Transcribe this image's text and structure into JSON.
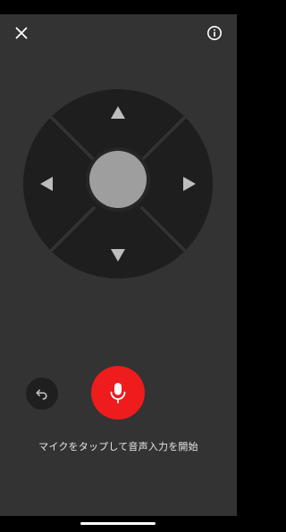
{
  "header": {
    "close_icon": "close-icon",
    "info_icon": "info-icon"
  },
  "dpad": {
    "up_icon": "arrow-up-icon",
    "down_icon": "arrow-down-icon",
    "left_icon": "arrow-left-icon",
    "right_icon": "arrow-right-icon"
  },
  "controls": {
    "undo_icon": "undo-icon",
    "mic_icon": "microphone-icon"
  },
  "hint": {
    "text": "マイクをタップして音声入力を開始"
  },
  "colors": {
    "background": "#333333",
    "dpad": "#1e1e1e",
    "center_button": "#9e9e9e",
    "mic_button": "#ee1c1c",
    "arrow": "#bdbdbd"
  }
}
